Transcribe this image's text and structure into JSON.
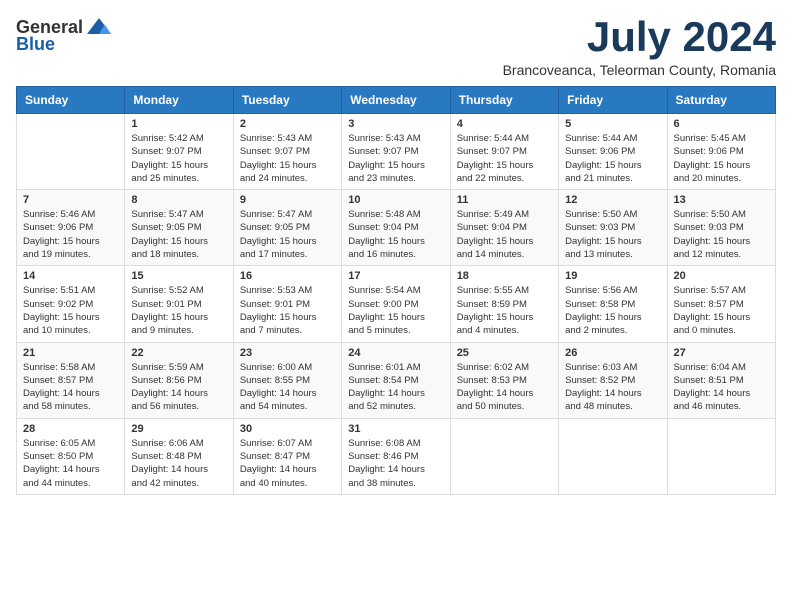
{
  "header": {
    "logo_general": "General",
    "logo_blue": "Blue",
    "month_title": "July 2024",
    "subtitle": "Brancoveanca, Teleorman County, Romania"
  },
  "weekdays": [
    "Sunday",
    "Monday",
    "Tuesday",
    "Wednesday",
    "Thursday",
    "Friday",
    "Saturday"
  ],
  "weeks": [
    [
      {
        "day": "",
        "info": ""
      },
      {
        "day": "1",
        "info": "Sunrise: 5:42 AM\nSunset: 9:07 PM\nDaylight: 15 hours\nand 25 minutes."
      },
      {
        "day": "2",
        "info": "Sunrise: 5:43 AM\nSunset: 9:07 PM\nDaylight: 15 hours\nand 24 minutes."
      },
      {
        "day": "3",
        "info": "Sunrise: 5:43 AM\nSunset: 9:07 PM\nDaylight: 15 hours\nand 23 minutes."
      },
      {
        "day": "4",
        "info": "Sunrise: 5:44 AM\nSunset: 9:07 PM\nDaylight: 15 hours\nand 22 minutes."
      },
      {
        "day": "5",
        "info": "Sunrise: 5:44 AM\nSunset: 9:06 PM\nDaylight: 15 hours\nand 21 minutes."
      },
      {
        "day": "6",
        "info": "Sunrise: 5:45 AM\nSunset: 9:06 PM\nDaylight: 15 hours\nand 20 minutes."
      }
    ],
    [
      {
        "day": "7",
        "info": "Sunrise: 5:46 AM\nSunset: 9:06 PM\nDaylight: 15 hours\nand 19 minutes."
      },
      {
        "day": "8",
        "info": "Sunrise: 5:47 AM\nSunset: 9:05 PM\nDaylight: 15 hours\nand 18 minutes."
      },
      {
        "day": "9",
        "info": "Sunrise: 5:47 AM\nSunset: 9:05 PM\nDaylight: 15 hours\nand 17 minutes."
      },
      {
        "day": "10",
        "info": "Sunrise: 5:48 AM\nSunset: 9:04 PM\nDaylight: 15 hours\nand 16 minutes."
      },
      {
        "day": "11",
        "info": "Sunrise: 5:49 AM\nSunset: 9:04 PM\nDaylight: 15 hours\nand 14 minutes."
      },
      {
        "day": "12",
        "info": "Sunrise: 5:50 AM\nSunset: 9:03 PM\nDaylight: 15 hours\nand 13 minutes."
      },
      {
        "day": "13",
        "info": "Sunrise: 5:50 AM\nSunset: 9:03 PM\nDaylight: 15 hours\nand 12 minutes."
      }
    ],
    [
      {
        "day": "14",
        "info": "Sunrise: 5:51 AM\nSunset: 9:02 PM\nDaylight: 15 hours\nand 10 minutes."
      },
      {
        "day": "15",
        "info": "Sunrise: 5:52 AM\nSunset: 9:01 PM\nDaylight: 15 hours\nand 9 minutes."
      },
      {
        "day": "16",
        "info": "Sunrise: 5:53 AM\nSunset: 9:01 PM\nDaylight: 15 hours\nand 7 minutes."
      },
      {
        "day": "17",
        "info": "Sunrise: 5:54 AM\nSunset: 9:00 PM\nDaylight: 15 hours\nand 5 minutes."
      },
      {
        "day": "18",
        "info": "Sunrise: 5:55 AM\nSunset: 8:59 PM\nDaylight: 15 hours\nand 4 minutes."
      },
      {
        "day": "19",
        "info": "Sunrise: 5:56 AM\nSunset: 8:58 PM\nDaylight: 15 hours\nand 2 minutes."
      },
      {
        "day": "20",
        "info": "Sunrise: 5:57 AM\nSunset: 8:57 PM\nDaylight: 15 hours\nand 0 minutes."
      }
    ],
    [
      {
        "day": "21",
        "info": "Sunrise: 5:58 AM\nSunset: 8:57 PM\nDaylight: 14 hours\nand 58 minutes."
      },
      {
        "day": "22",
        "info": "Sunrise: 5:59 AM\nSunset: 8:56 PM\nDaylight: 14 hours\nand 56 minutes."
      },
      {
        "day": "23",
        "info": "Sunrise: 6:00 AM\nSunset: 8:55 PM\nDaylight: 14 hours\nand 54 minutes."
      },
      {
        "day": "24",
        "info": "Sunrise: 6:01 AM\nSunset: 8:54 PM\nDaylight: 14 hours\nand 52 minutes."
      },
      {
        "day": "25",
        "info": "Sunrise: 6:02 AM\nSunset: 8:53 PM\nDaylight: 14 hours\nand 50 minutes."
      },
      {
        "day": "26",
        "info": "Sunrise: 6:03 AM\nSunset: 8:52 PM\nDaylight: 14 hours\nand 48 minutes."
      },
      {
        "day": "27",
        "info": "Sunrise: 6:04 AM\nSunset: 8:51 PM\nDaylight: 14 hours\nand 46 minutes."
      }
    ],
    [
      {
        "day": "28",
        "info": "Sunrise: 6:05 AM\nSunset: 8:50 PM\nDaylight: 14 hours\nand 44 minutes."
      },
      {
        "day": "29",
        "info": "Sunrise: 6:06 AM\nSunset: 8:48 PM\nDaylight: 14 hours\nand 42 minutes."
      },
      {
        "day": "30",
        "info": "Sunrise: 6:07 AM\nSunset: 8:47 PM\nDaylight: 14 hours\nand 40 minutes."
      },
      {
        "day": "31",
        "info": "Sunrise: 6:08 AM\nSunset: 8:46 PM\nDaylight: 14 hours\nand 38 minutes."
      },
      {
        "day": "",
        "info": ""
      },
      {
        "day": "",
        "info": ""
      },
      {
        "day": "",
        "info": ""
      }
    ]
  ]
}
